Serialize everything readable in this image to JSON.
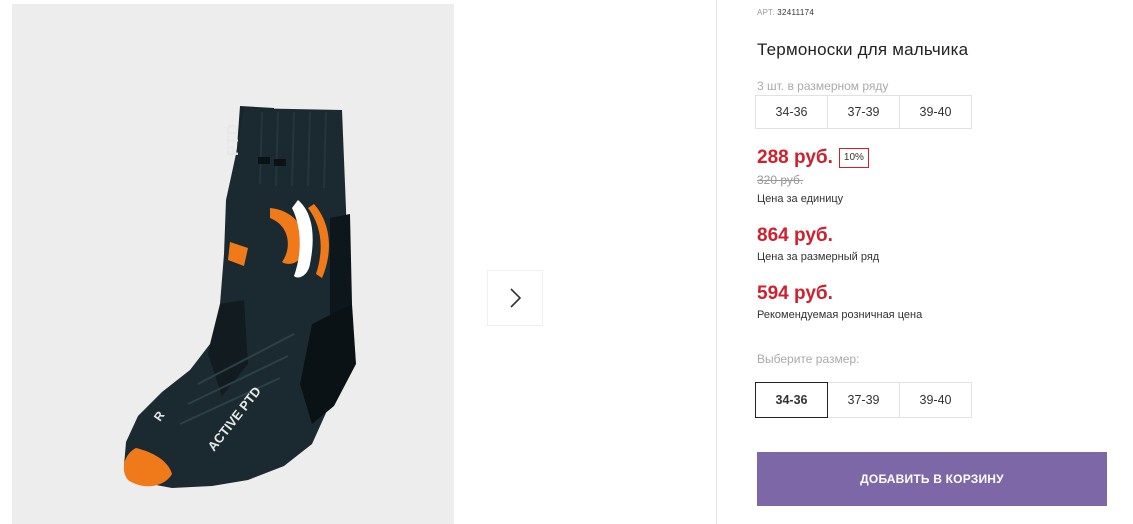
{
  "product": {
    "art_label": "АРТ.",
    "art_value": "32411174",
    "title": "Термоноски для мальчика",
    "image_text": "ACTIVE PTD"
  },
  "size_row": {
    "label": "3 шт. в размерном ряду",
    "sizes": [
      "34-36",
      "37-39",
      "39-40"
    ]
  },
  "prices": {
    "unit_price": "288 руб.",
    "discount": "10%",
    "old_price": "320 руб.",
    "unit_caption": "Цена за единицу",
    "row_price": "864 руб.",
    "row_caption": "Цена за размерный ряд",
    "retail_price": "594 руб.",
    "retail_caption": "Рекомендуемая розничная цена"
  },
  "size_select": {
    "label": "Выберите размер:",
    "options": [
      "34-36",
      "37-39",
      "39-40"
    ],
    "selected": "34-36"
  },
  "cart": {
    "button_label": "ДОБАВИТЬ В КОРЗИНУ"
  },
  "gallery": {
    "next_icon": "chevron-right-icon"
  },
  "colors": {
    "price_red": "#d0202e",
    "button_purple": "#7d67a6",
    "sock_body": "#1b2a30",
    "sock_accent": "#f07a1a"
  }
}
